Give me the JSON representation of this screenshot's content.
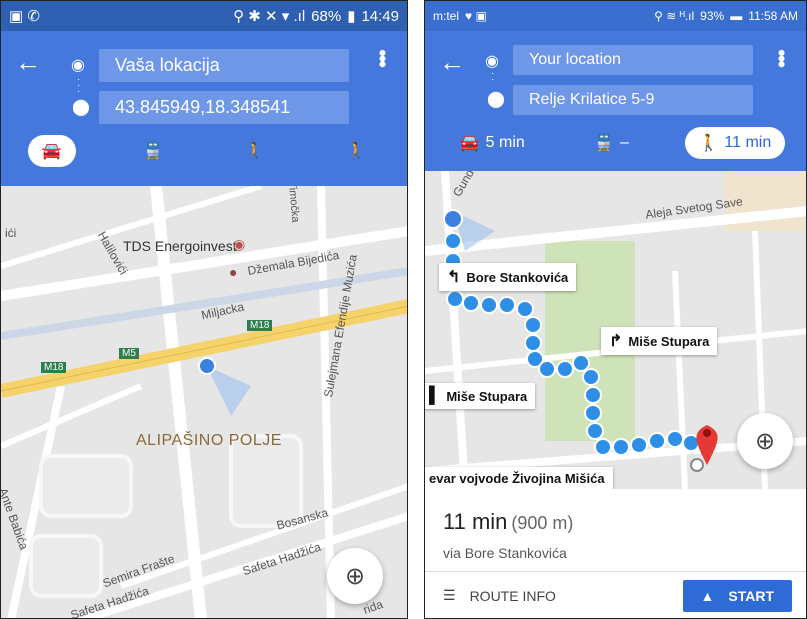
{
  "left": {
    "status": {
      "left_icons": "▣ ✆",
      "right_icons": "⚲ ✱ ✕ ▾ .ıl",
      "battery": "68%",
      "time": "14:49"
    },
    "origin": "Vaša lokacija",
    "destination": "43.845949,18.348541",
    "modes": [
      "car-icon",
      "transit-icon",
      "walk-icon",
      "ride-icon"
    ],
    "map": {
      "poi_tds": "TDS Energoinvest",
      "street_dzemala": "Džemala Bijedića",
      "street_halilovici": "Halilovići",
      "street_timocka": "Timočka",
      "river": "Miljacka",
      "m18a": "M18",
      "m18b": "M18",
      "m5": "M5",
      "district": "ALIPAŠINO POLJE",
      "street_sulejmana": "Sulejmana Efendije Muzića",
      "street_ante": "Ante Babića",
      "street_bosanska": "Bosanska",
      "street_semira": "Semira Frašte",
      "street_safeta1": "Safeta Hadžića",
      "street_safeta2": "Safeta Hadžića",
      "street_dici": "ići",
      "street_rida": "rida"
    }
  },
  "right": {
    "status": {
      "carrier": "m:tel",
      "right_icons": "⚲ ≋ ᴴ.ıl",
      "battery": "93%",
      "time": "11:58 AM"
    },
    "origin": "Your location",
    "destination": "Relje Krilatice 5-9",
    "modes": [
      {
        "icon": "car-icon",
        "label": "5 min"
      },
      {
        "icon": "transit-icon",
        "label": "–"
      },
      {
        "icon": "walk-icon",
        "label": "11 min"
      }
    ],
    "map": {
      "street_aleja": "Aleja Svetog Save",
      "street_gundu": "Gundu",
      "callout_bore": "Bore Stankovića",
      "callout_mise1": "Miše Stupara",
      "callout_mise2": "Miše Stupara",
      "callout_vojvode": "evar vojvode Živojina Mišića"
    },
    "summary": {
      "time": "11 min",
      "distance": "(900 m)",
      "via": "via Bore Stankovića",
      "route_info": "ROUTE INFO",
      "start": "START"
    }
  },
  "colors": {
    "header": "#4478dc",
    "route_dot": "#2f8fe6",
    "pin": "#e53935",
    "highway": "#f6d36a"
  }
}
